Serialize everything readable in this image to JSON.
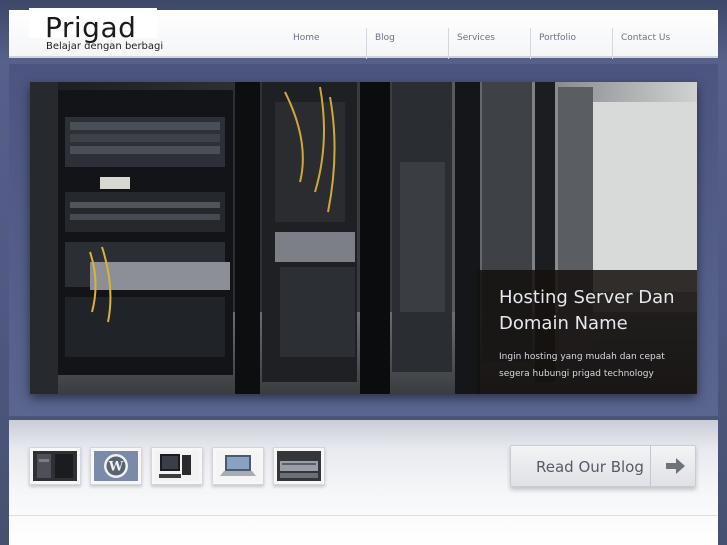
{
  "header": {
    "site_title": "Prigad",
    "tagline": "Belajar dengan berbagi"
  },
  "nav": {
    "items": [
      {
        "label": "Home"
      },
      {
        "label": "Blog"
      },
      {
        "label": "Services"
      },
      {
        "label": "Portfolio"
      },
      {
        "label": "Contact Us"
      }
    ]
  },
  "hero": {
    "image_icon": "server-room-photo",
    "caption_title": "Hosting Server Dan Domain Name",
    "caption_text": "Ingin hosting yang mudah dan cepat segera hubungi prigad technology"
  },
  "thumbnails": [
    {
      "icon": "server-rack-thumbnail"
    },
    {
      "icon": "wordpress-logo-thumbnail"
    },
    {
      "icon": "desktop-computer-thumbnail"
    },
    {
      "icon": "laptop-thumbnail"
    },
    {
      "icon": "server-hardware-thumbnail"
    }
  ],
  "cta": {
    "label": "Read Our Blog",
    "icon": "arrow-right-icon"
  },
  "colors": {
    "background": "#4a5478",
    "caption_bg": "#15100e",
    "nav_text": "#6a7286"
  }
}
